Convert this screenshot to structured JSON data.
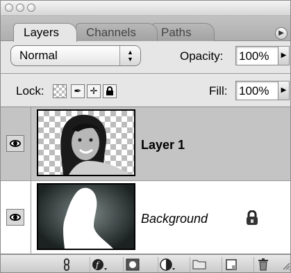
{
  "tabs": [
    {
      "label": "Layers",
      "active": true
    },
    {
      "label": "Channels",
      "active": false
    },
    {
      "label": "Paths",
      "active": false
    }
  ],
  "options": {
    "blend_mode": "Normal",
    "opacity_label": "Opacity:",
    "opacity_value": "100%",
    "lock_label": "Lock:",
    "fill_label": "Fill:",
    "fill_value": "100%"
  },
  "layers": [
    {
      "name": "Layer 1",
      "visible": true,
      "selected": true,
      "style": "bold"
    },
    {
      "name": "Background",
      "visible": true,
      "selected": false,
      "style": "italic",
      "locked": true
    }
  ],
  "icons": {
    "window_buttons": [
      "close-icon",
      "minimize-icon",
      "zoom-icon"
    ],
    "panel_menu": "panel-menu-icon",
    "lock_buttons": [
      "lock-transparent-pixels-icon",
      "lock-image-pixels-icon",
      "lock-position-icon",
      "lock-all-icon"
    ],
    "bottom_toolbar": [
      "link-layers-icon",
      "layer-style-icon",
      "layer-mask-icon",
      "adjustment-layer-icon",
      "new-group-icon",
      "new-layer-icon",
      "delete-layer-icon"
    ]
  },
  "colors": {
    "panel_bg": "#e6e6e6",
    "selected_row": "#c4c4c4",
    "list_bg": "#ffffff"
  }
}
